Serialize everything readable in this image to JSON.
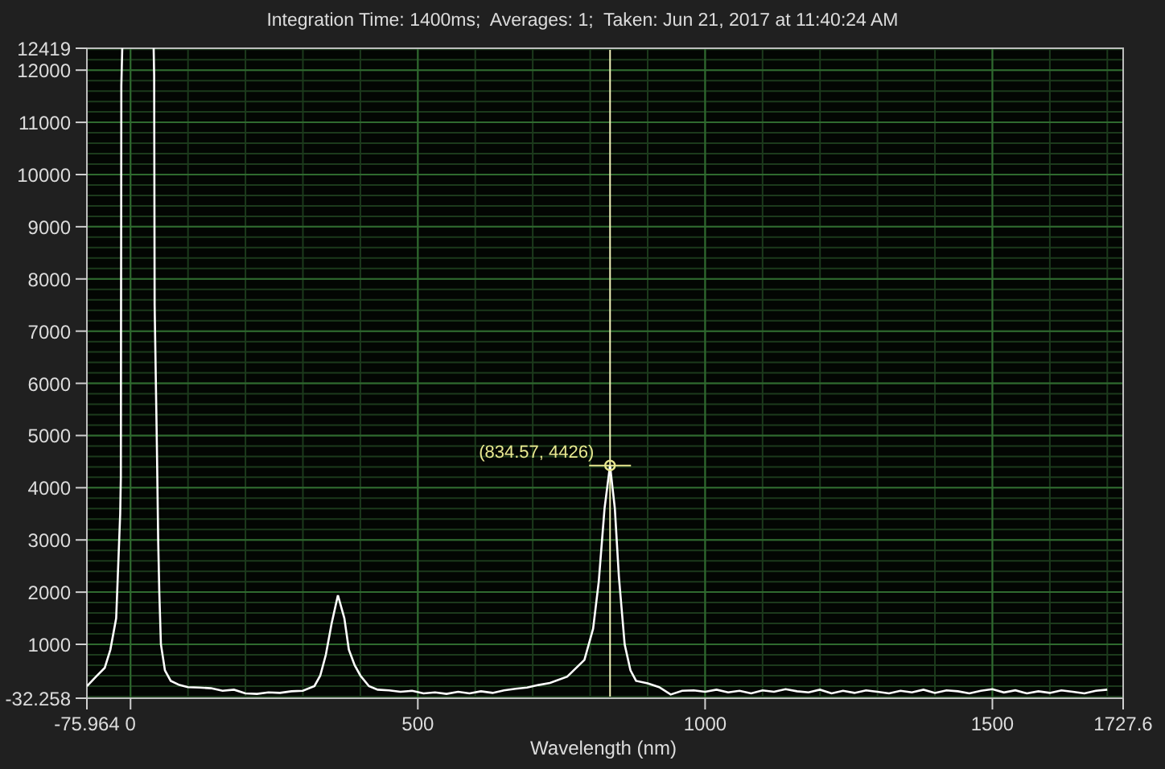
{
  "chart_data": {
    "type": "line",
    "title": "Integration Time: 1400ms;  Averages: 1;  Taken: Jun 21, 2017 at 11:40:24 AM",
    "xlabel": "Wavelength (nm)",
    "x": [
      -75.964,
      -60,
      -45,
      -35,
      -25,
      -18,
      -17,
      -16,
      -14,
      40,
      41,
      42,
      46,
      48,
      50,
      53,
      60,
      70,
      85,
      100,
      120,
      140,
      160,
      180,
      200,
      220,
      240,
      260,
      280,
      300,
      320,
      330,
      340,
      350,
      361,
      372,
      380,
      390,
      400,
      415,
      430,
      450,
      470,
      490,
      510,
      530,
      550,
      570,
      590,
      610,
      630,
      650,
      670,
      690,
      710,
      730,
      760,
      790,
      805,
      815,
      825,
      834.57,
      843,
      850,
      860,
      870,
      880,
      900,
      920,
      940,
      960,
      980,
      1000,
      1020,
      1040,
      1060,
      1080,
      1100,
      1120,
      1140,
      1160,
      1180,
      1200,
      1220,
      1240,
      1260,
      1280,
      1300,
      1320,
      1340,
      1360,
      1380,
      1400,
      1420,
      1440,
      1460,
      1480,
      1500,
      1520,
      1540,
      1560,
      1580,
      1600,
      1620,
      1640,
      1660,
      1680,
      1700
    ],
    "series": [
      {
        "color": "#ffffff",
        "values": [
          200,
          380,
          550,
          900,
          1500,
          3500,
          4200,
          11700,
          null,
          null,
          11900,
          7500,
          4800,
          3000,
          2000,
          1000,
          500,
          300,
          220,
          180,
          170,
          160,
          110,
          130,
          60,
          50,
          80,
          70,
          100,
          110,
          200,
          400,
          800,
          1400,
          1940,
          1500,
          900,
          600,
          400,
          200,
          130,
          120,
          90,
          110,
          60,
          80,
          50,
          90,
          60,
          100,
          70,
          120,
          150,
          170,
          220,
          260,
          380,
          700,
          1300,
          2200,
          3600,
          4426,
          3600,
          2300,
          1000,
          500,
          300,
          250,
          180,
          40,
          110,
          120,
          90,
          130,
          80,
          110,
          60,
          120,
          90,
          140,
          100,
          80,
          130,
          60,
          110,
          70,
          120,
          90,
          60,
          110,
          80,
          130,
          70,
          120,
          100,
          60,
          110,
          140,
          80,
          120,
          60,
          100,
          70,
          120,
          90,
          60,
          110,
          130
        ]
      }
    ],
    "xlim": [
      -75.964,
      1727.6
    ],
    "ylim": [
      -32.258,
      12419
    ],
    "xticks": [
      -75.964,
      0,
      500,
      1000,
      1500,
      1727.6
    ],
    "yticks": [
      -32.258,
      1000,
      2000,
      3000,
      4000,
      5000,
      6000,
      7000,
      8000,
      9000,
      10000,
      11000,
      12000,
      12419
    ],
    "grid": true,
    "ref_lines": [
      {
        "axis": "x",
        "value": 834.57,
        "color": "#f0f0b8"
      }
    ],
    "annotations": [
      {
        "x": 834.57,
        "y": 4426,
        "text": "(834.57, 4426)"
      }
    ]
  }
}
